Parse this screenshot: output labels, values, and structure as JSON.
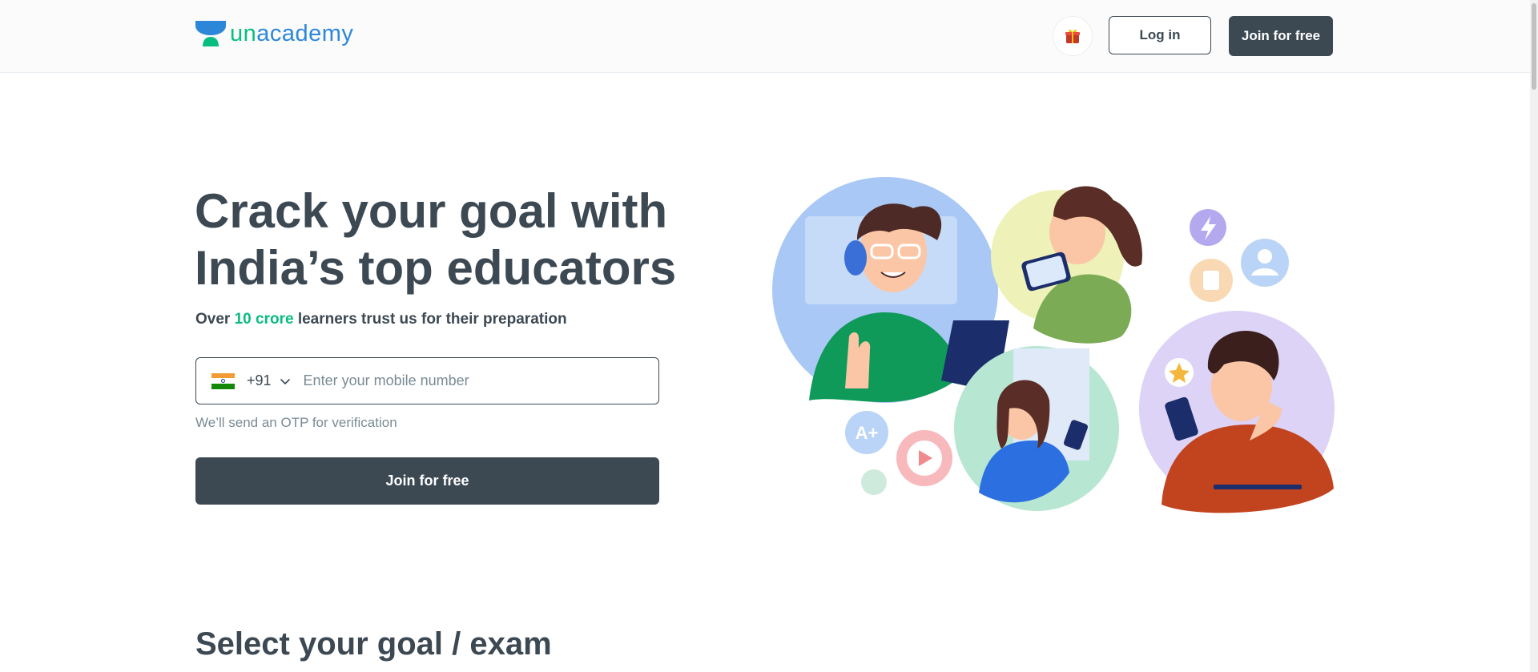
{
  "header": {
    "logo": {
      "prefix": "un",
      "suffix": "academy"
    },
    "gift_icon": "gift-icon",
    "login_label": "Log in",
    "join_label": "Join for free"
  },
  "hero": {
    "title_line1": "Crack your goal with",
    "title_line2": "India’s top educators",
    "subtitle_pre": "Over ",
    "subtitle_highlight": "10 crore",
    "subtitle_post": " learners trust us for their preparation",
    "phone": {
      "flag_icon": "india-flag-icon",
      "country_code": "+91",
      "placeholder": "Enter your mobile number",
      "value": ""
    },
    "otp_note": "We’ll send an OTP for verification",
    "join_label": "Join for free"
  },
  "illustration": {
    "badge_grade": "A+"
  },
  "section": {
    "title": "Select your goal / exam"
  },
  "colors": {
    "brand_green": "#08bd80",
    "brand_blue": "#2d87d9",
    "text_dark": "#3c4852",
    "text_muted": "#7a8b94",
    "button_dark": "#3c4852"
  }
}
